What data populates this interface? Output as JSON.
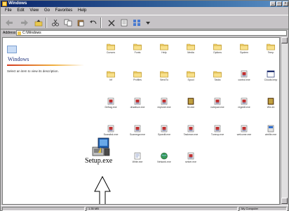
{
  "window": {
    "title": "Windows",
    "controls": [
      "_",
      "□",
      "×"
    ]
  },
  "menubar": {
    "items": [
      "File",
      "Edit",
      "View",
      "Go",
      "Favorites",
      "Help"
    ]
  },
  "address": {
    "label": "Address",
    "value": "C:\\Windows"
  },
  "leftpane": {
    "title": "Windows",
    "hint": "Select an item to view its description."
  },
  "files": [
    {
      "name": "Cursors",
      "type": "folder"
    },
    {
      "name": "Fonts",
      "type": "folder"
    },
    {
      "name": "Help",
      "type": "folder"
    },
    {
      "name": "Media",
      "type": "folder"
    },
    {
      "name": "Options",
      "type": "folder"
    },
    {
      "name": "System",
      "type": "folder"
    },
    {
      "name": "Temp",
      "type": "folder"
    },
    {
      "name": "Inf",
      "type": "folder"
    },
    {
      "name": "Profiles",
      "type": "folder"
    },
    {
      "name": "SendTo",
      "type": "folder"
    },
    {
      "name": "Spool",
      "type": "folder"
    },
    {
      "name": "Tasks",
      "type": "folder"
    },
    {
      "name": "control.exe",
      "type": "exe"
    },
    {
      "name": "Clouds.bmp",
      "type": "window"
    },
    {
      "name": "Defrag.exe",
      "type": "exe"
    },
    {
      "name": "drwatson.exe",
      "type": "exe"
    },
    {
      "name": "explorer.exe",
      "type": "exe"
    },
    {
      "name": "hh.exe",
      "type": "book"
    },
    {
      "name": "notepad.exe",
      "type": "exe"
    },
    {
      "name": "regedit.exe",
      "type": "exe"
    },
    {
      "name": "Win.ini",
      "type": "book"
    },
    {
      "name": "Scandisk.exe",
      "type": "exe"
    },
    {
      "name": "Scanregw.exe",
      "type": "exe"
    },
    {
      "name": "Sysedit.exe",
      "type": "exe"
    },
    {
      "name": "Taskman.exe",
      "type": "exe"
    },
    {
      "name": "Tuneup.exe",
      "type": "exe"
    },
    {
      "name": "welcome.exe",
      "type": "exe"
    },
    {
      "name": "winfile.exe",
      "type": "shell"
    },
    {
      "name": "Write.exe",
      "type": "doc"
    },
    {
      "name": "Network.exe",
      "type": "globe"
    },
    {
      "name": "setver.exe",
      "type": "exe"
    }
  ],
  "setup": {
    "name": "Setup.exe"
  },
  "status": {
    "left": "",
    "mid": "1.35 MB",
    "right": "My Computer"
  }
}
